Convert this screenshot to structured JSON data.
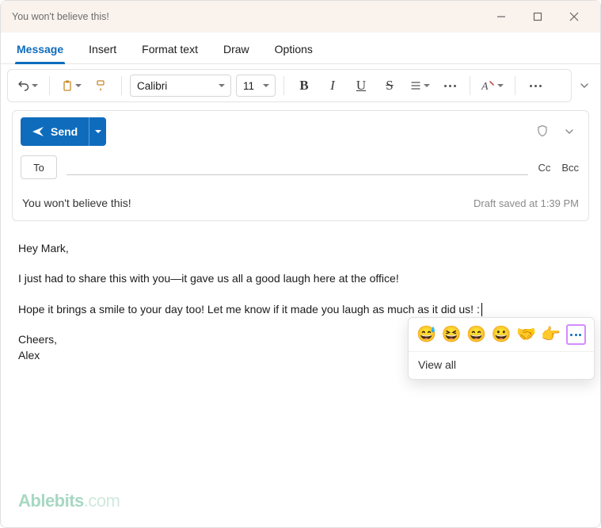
{
  "window": {
    "title": "You won't believe this!"
  },
  "tabs": {
    "items": [
      "Message",
      "Insert",
      "Format text",
      "Draw",
      "Options"
    ],
    "active_index": 0
  },
  "ribbon": {
    "font_name": "Calibri",
    "font_size": "11"
  },
  "actions": {
    "send_label": "Send"
  },
  "recipients": {
    "to_label": "To",
    "cc_label": "Cc",
    "bcc_label": "Bcc"
  },
  "subject": "You won't believe this!",
  "status": "Draft saved at 1:39 PM",
  "body": {
    "p1": "Hey Mark,",
    "p2": "I just had to share this with you—it gave us all a good laugh here at the office!",
    "p3": "Hope it brings a smile to your day too! Let me know if it made you laugh as much as it did us! :",
    "p4": "Cheers,",
    "p5": "Alex"
  },
  "emoji_popup": {
    "emojis": [
      "😅",
      "😆",
      "😄",
      "😀",
      "🤝",
      "👉"
    ],
    "view_all_label": "View all"
  },
  "watermark": {
    "brand": "Ablebits",
    "suffix": ".com"
  },
  "icons": {
    "undo": "undo-icon",
    "clipboard": "clipboard-icon",
    "format_painter": "format-painter-icon",
    "bold": "B",
    "italic": "I",
    "underline": "U",
    "strike": "S",
    "line_spacing": "line-spacing-icon",
    "clear_format": "clear-format-icon",
    "shield": "shield-icon"
  }
}
